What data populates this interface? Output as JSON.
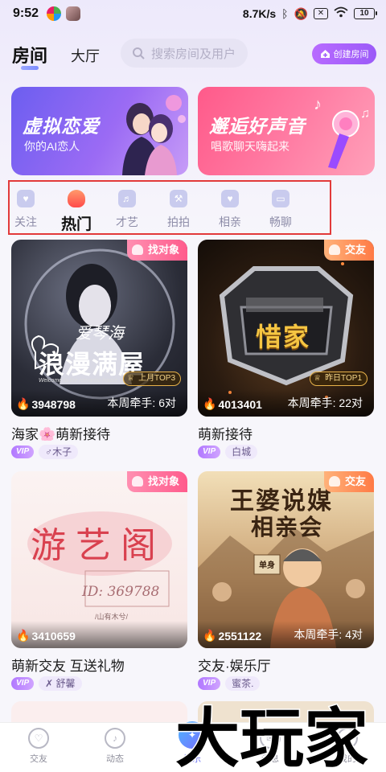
{
  "status_bar": {
    "time": "9:52",
    "net_speed": "8.7K/s",
    "battery": "10"
  },
  "header": {
    "tabs": [
      {
        "label": "房间",
        "active": true
      },
      {
        "label": "大厅",
        "active": false
      }
    ],
    "search_placeholder": "搜索房间及用户",
    "create_room_label": "创建房间"
  },
  "banners": [
    {
      "title": "虚拟恋爱",
      "subtitle": "你的AI恋人"
    },
    {
      "title": "邂逅好声音",
      "subtitle": "唱歌聊天嗨起来"
    }
  ],
  "categories": [
    {
      "label": "关注",
      "active": false,
      "icon": "heart-icon"
    },
    {
      "label": "热门",
      "active": true,
      "icon": "flame-icon"
    },
    {
      "label": "才艺",
      "active": false,
      "icon": "mic-icon"
    },
    {
      "label": "拍拍",
      "active": false,
      "icon": "gavel-icon"
    },
    {
      "label": "相亲",
      "active": false,
      "icon": "hearts-icon"
    },
    {
      "label": "畅聊",
      "active": false,
      "icon": "chat-icon"
    }
  ],
  "rooms": [
    {
      "tag": "找对象",
      "tag_color": "#ff5b8c",
      "heat": "3948798",
      "pairs": "本周牵手: 6对",
      "rank_badge": "上月TOP3",
      "cover_text": "浪漫满屋",
      "cover_script": "爱琴海",
      "cover_subtext": "Welcome to the romantic house",
      "title": "海家🌸萌新接待",
      "vip": "VIP",
      "host": "♂木子"
    },
    {
      "tag": "交友",
      "tag_color": "#ff7a45",
      "heat": "4013401",
      "pairs": "本周牵手: 22对",
      "rank_badge": "昨日TOP1",
      "cover_text": "惜家",
      "title": "萌新接待",
      "vip": "VIP",
      "host": "白城"
    },
    {
      "tag": "找对象",
      "tag_color": "#ff5b8c",
      "heat": "3410659",
      "pairs": "",
      "cover_text": "游艺阁",
      "cover_subtext": "ID: 369788",
      "cover_caption": "/山有木兮/",
      "title": "萌新交友 互送礼物",
      "vip": "VIP",
      "host": "✗ 舒馨"
    },
    {
      "tag": "交友",
      "tag_color": "#ff7a45",
      "heat": "2551122",
      "pairs": "本周牵手: 4对",
      "cover_text": "王婆说媒",
      "cover_subtext": "相亲会",
      "cover_sign": "单身",
      "title": "交友·娱乐厅",
      "vip": "VIP",
      "host": "蜜茶."
    }
  ],
  "bottom_nav": [
    {
      "label": "交友",
      "icon": "heart-circle-icon",
      "active": false
    },
    {
      "label": "动态",
      "icon": "music-note-icon",
      "active": false
    },
    {
      "label": "娱乐",
      "icon": "planet-icon",
      "active": true
    },
    {
      "label": "消息",
      "icon": "message-icon",
      "active": false
    },
    {
      "label": "我的",
      "icon": "profile-icon",
      "active": false
    }
  ],
  "watermark_text": "大玩家",
  "colors": {
    "accent": "#9b5af8",
    "highlight_border": "#e23a3a",
    "nav_active": "#6a6ff0"
  }
}
